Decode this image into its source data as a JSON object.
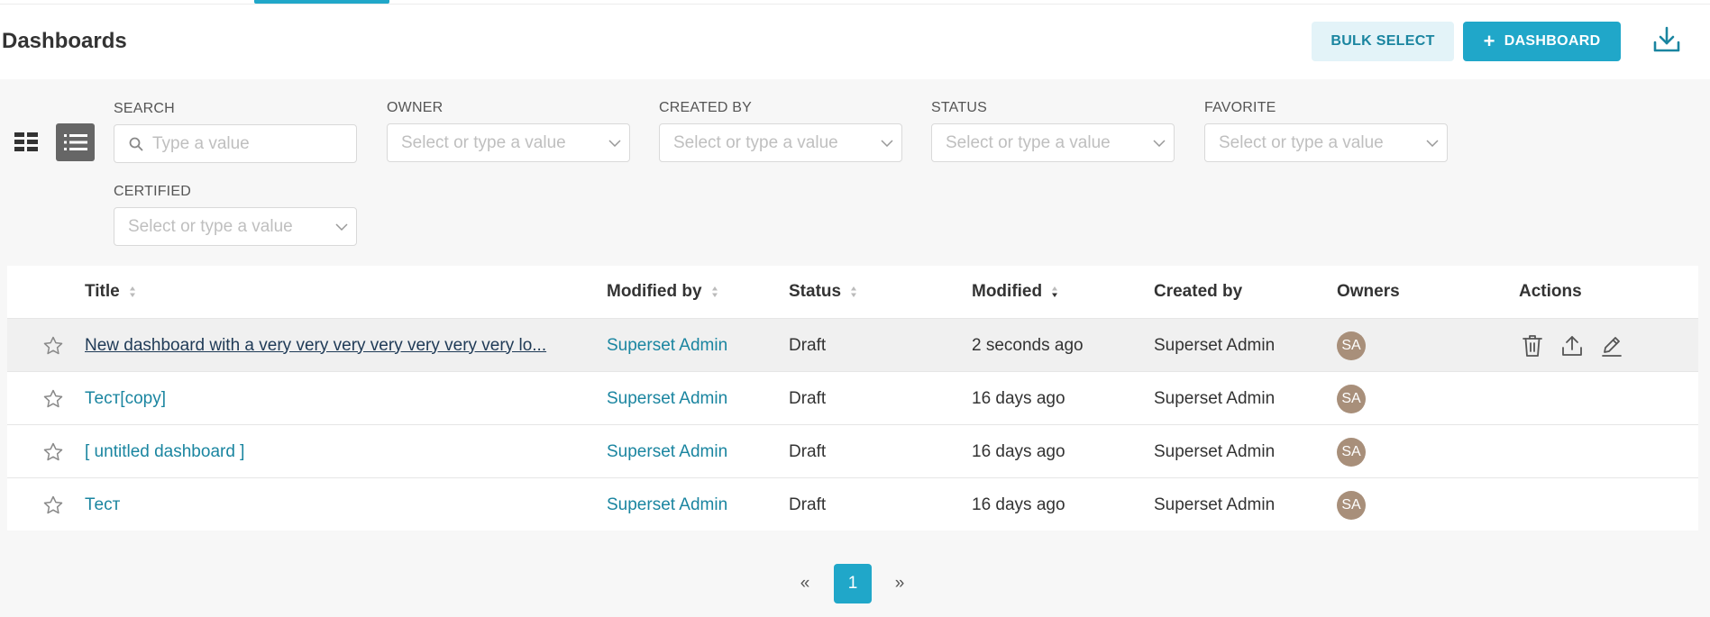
{
  "header": {
    "title": "Dashboards",
    "bulk_select_label": "BULK SELECT",
    "add_dashboard_label": "DASHBOARD",
    "add_icon": "plus-icon",
    "import_icon": "download-icon"
  },
  "view_toggle": {
    "card_view_icon": "grid-icon",
    "list_view_icon": "list-icon",
    "active": "list"
  },
  "filters": {
    "search": {
      "label": "SEARCH",
      "placeholder": "Type a value"
    },
    "owner": {
      "label": "OWNER",
      "placeholder": "Select or type a value"
    },
    "created_by": {
      "label": "CREATED BY",
      "placeholder": "Select or type a value"
    },
    "status": {
      "label": "STATUS",
      "placeholder": "Select or type a value"
    },
    "favorite": {
      "label": "FAVORITE",
      "placeholder": "Select or type a value"
    },
    "certified": {
      "label": "CERTIFIED",
      "placeholder": "Select or type a value"
    }
  },
  "table": {
    "columns": [
      "Title",
      "Modified by",
      "Status",
      "Modified",
      "Created by",
      "Owners",
      "Actions"
    ],
    "sorted_column": "Modified",
    "rows": [
      {
        "title": "New dashboard with a very very very very very very very lo...",
        "modified_by": "Superset Admin",
        "status": "Draft",
        "modified": "2 seconds ago",
        "created_by": "Superset Admin",
        "owner_initials": "SA"
      },
      {
        "title": "Тест[copy]",
        "modified_by": "Superset Admin",
        "status": "Draft",
        "modified": "16 days ago",
        "created_by": "Superset Admin",
        "owner_initials": "SA"
      },
      {
        "title": "[ untitled dashboard ]",
        "modified_by": "Superset Admin",
        "status": "Draft",
        "modified": "16 days ago",
        "created_by": "Superset Admin",
        "owner_initials": "SA"
      },
      {
        "title": "Тест",
        "modified_by": "Superset Admin",
        "status": "Draft",
        "modified": "16 days ago",
        "created_by": "Superset Admin",
        "owner_initials": "SA"
      }
    ],
    "row_actions": [
      "trash-icon",
      "share-icon",
      "edit-icon"
    ]
  },
  "pagination": {
    "prev": "«",
    "current": "1",
    "next": "»"
  },
  "colors": {
    "primary": "#20a7c9",
    "link": "#1a85a0",
    "avatar": "#a88f7a"
  }
}
